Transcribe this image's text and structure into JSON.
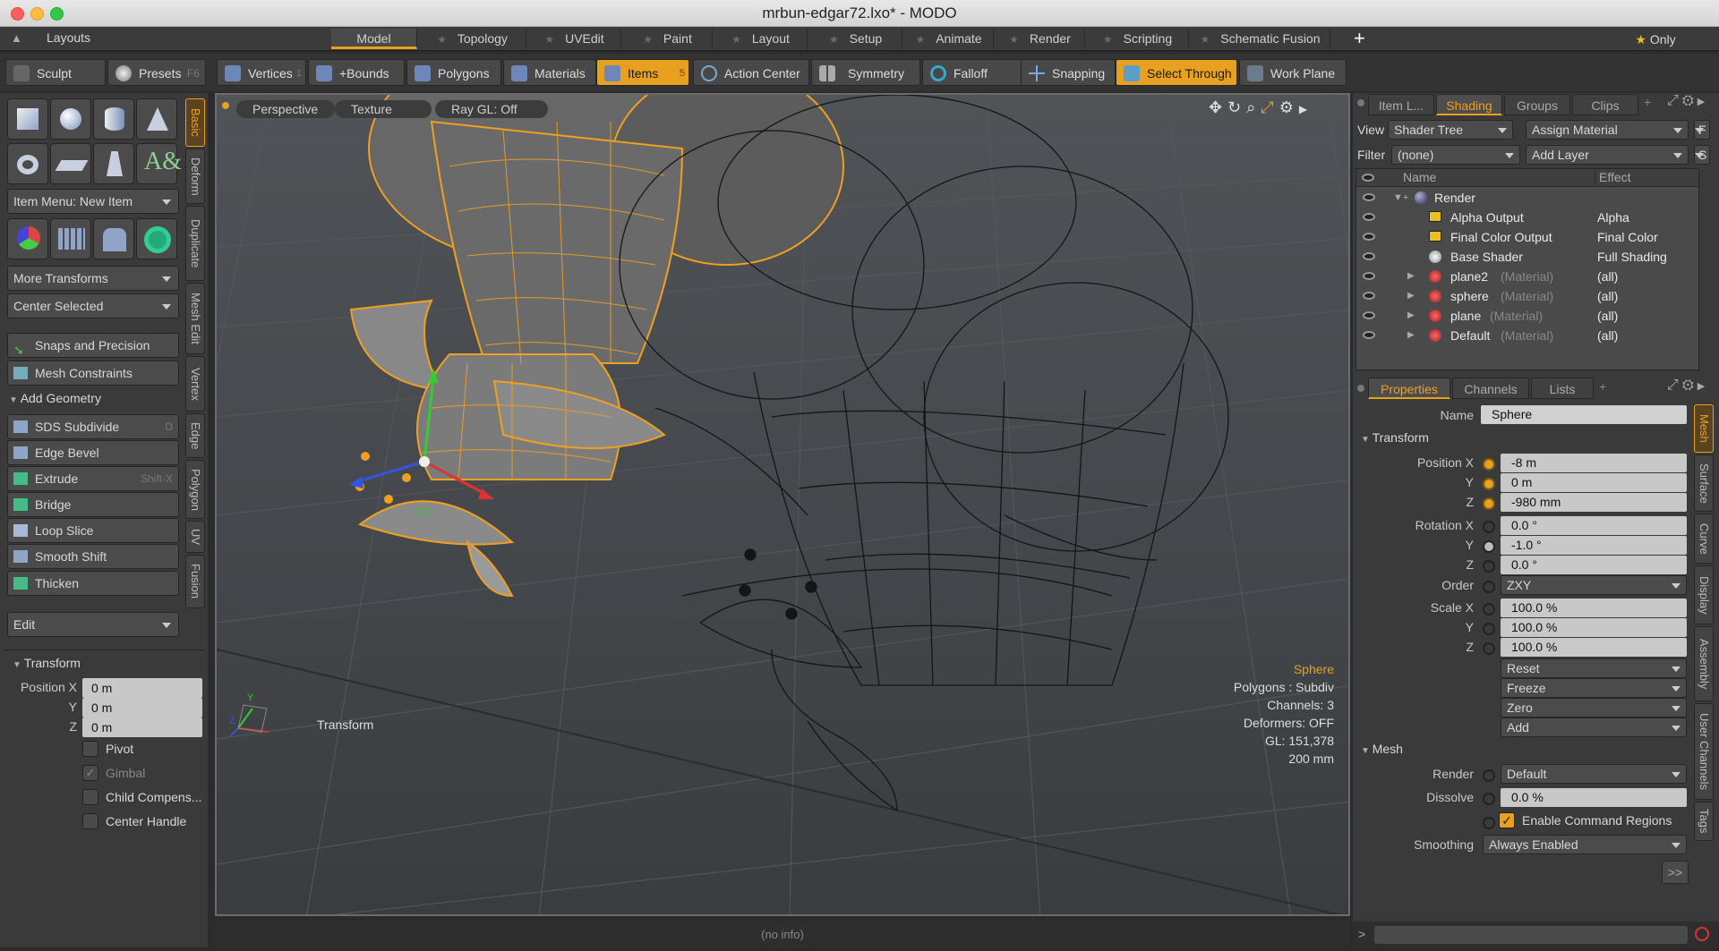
{
  "window": {
    "title": "mrbun-edgar72.lxo* - MODO"
  },
  "layouts_label": "Layouts",
  "layout_tabs": [
    {
      "label": "Model"
    },
    {
      "label": "Topology"
    },
    {
      "label": "UVEdit"
    },
    {
      "label": "Paint"
    },
    {
      "label": "Layout"
    },
    {
      "label": "Setup"
    },
    {
      "label": "Animate"
    },
    {
      "label": "Render"
    },
    {
      "label": "Scripting"
    },
    {
      "label": "Schematic Fusion"
    }
  ],
  "add_tab_label": "+",
  "only_label": "Only",
  "toolbar": {
    "sculpt": "Sculpt",
    "presets": "Presets",
    "presets_key": "F6",
    "vertices": "Vertices",
    "vertices_num": "1",
    "bounds": "+Bounds",
    "polygons": "Polygons",
    "materials": "Materials",
    "items": "Items",
    "items_num": "5",
    "action_center": "Action Center",
    "symmetry": "Symmetry",
    "falloff": "Falloff",
    "snapping": "Snapping",
    "select_through": "Select Through",
    "work_plane": "Work Plane"
  },
  "left": {
    "item_menu": "Item Menu: New Item",
    "more_transforms": "More Transforms",
    "center_selected": "Center Selected",
    "snaps": "Snaps and Precision",
    "mesh_constraints": "Mesh Constraints",
    "add_geometry": "Add Geometry",
    "sds": "SDS Subdivide",
    "sds_key": "D",
    "edge_bevel": "Edge Bevel",
    "extrude": "Extrude",
    "extrude_key": "Shift-X",
    "bridge": "Bridge",
    "loop_slice": "Loop Slice",
    "smooth_shift": "Smooth Shift",
    "thicken": "Thicken",
    "edit": "Edit",
    "transform_head": "Transform",
    "position_x_label": "Position X",
    "y_label": "Y",
    "z_label": "Z",
    "pos_x": "0 m",
    "pos_y": "0 m",
    "pos_z": "0 m",
    "pivot": "Pivot",
    "gimbal": "Gimbal",
    "child": "Child Compens...",
    "center_handle": "Center Handle",
    "vtabs": [
      "Basic",
      "Deform",
      "Duplicate",
      "Mesh Edit",
      "Vertex",
      "Edge",
      "Polygon",
      "UV",
      "Fusion"
    ]
  },
  "viewport": {
    "perspective": "Perspective",
    "texture": "Texture",
    "raygl": "Ray GL: Off",
    "transform_label": "Transform",
    "info": {
      "name": "Sphere",
      "polygons": "Polygons : Subdiv",
      "channels": "Channels: 3",
      "deformers": "Deformers: OFF",
      "gl": "GL: 151,378",
      "scale": "200 mm"
    },
    "axis_y": "Y",
    "axis_z": "Z"
  },
  "shading": {
    "tabs": [
      "Item L...",
      "Shading",
      "Groups",
      "Clips"
    ],
    "view_label": "View",
    "view_value": "Shader Tree",
    "assign_material": "Assign Material",
    "f_label": "F",
    "filter_label": "Filter",
    "filter_value": "(none)",
    "add_layer": "Add Layer",
    "s_label": "S",
    "col_name": "Name",
    "col_effect": "Effect",
    "rows": [
      {
        "name": "Render",
        "tag": "",
        "effect": ""
      },
      {
        "name": "Alpha Output",
        "tag": "",
        "effect": "Alpha"
      },
      {
        "name": "Final Color Output",
        "tag": "",
        "effect": "Final Color"
      },
      {
        "name": "Base Shader",
        "tag": "",
        "effect": "Full Shading"
      },
      {
        "name": "plane2",
        "tag": "(Material)",
        "effect": "(all)"
      },
      {
        "name": "sphere",
        "tag": "(Material)",
        "effect": "(all)"
      },
      {
        "name": "plane",
        "tag": "(Material)",
        "effect": "(all)"
      },
      {
        "name": "Default",
        "tag": "(Material)",
        "effect": "(all)"
      }
    ]
  },
  "properties": {
    "tabs": [
      "Properties",
      "Channels",
      "Lists"
    ],
    "name_label": "Name",
    "name_value": "Sphere",
    "transform": "Transform",
    "position_x": "Position X",
    "y": "Y",
    "z": "Z",
    "pos": [
      "-8 m",
      "0 m",
      "-980 mm"
    ],
    "rotation_x": "Rotation X",
    "rot": [
      "0.0 °",
      "-1.0 °",
      "0.0 °"
    ],
    "order_label": "Order",
    "order_value": "ZXY",
    "scale_x": "Scale X",
    "scale": [
      "100.0 %",
      "100.0 %",
      "100.0 %"
    ],
    "reset": "Reset",
    "freeze": "Freeze",
    "zero": "Zero",
    "add": "Add",
    "mesh_head": "Mesh",
    "render_label": "Render",
    "render_value": "Default",
    "dissolve_label": "Dissolve",
    "dissolve_value": "0.0 %",
    "enable_cmd": "Enable Command Regions",
    "smoothing_label": "Smoothing",
    "smoothing_value": "Always Enabled",
    "more": ">>",
    "vtabs": [
      "Mesh",
      "Surface",
      "Curve",
      "Display",
      "Assembly",
      "User Channels",
      "Tags"
    ]
  },
  "status": {
    "info": "(no info)",
    "prompt": ">"
  }
}
